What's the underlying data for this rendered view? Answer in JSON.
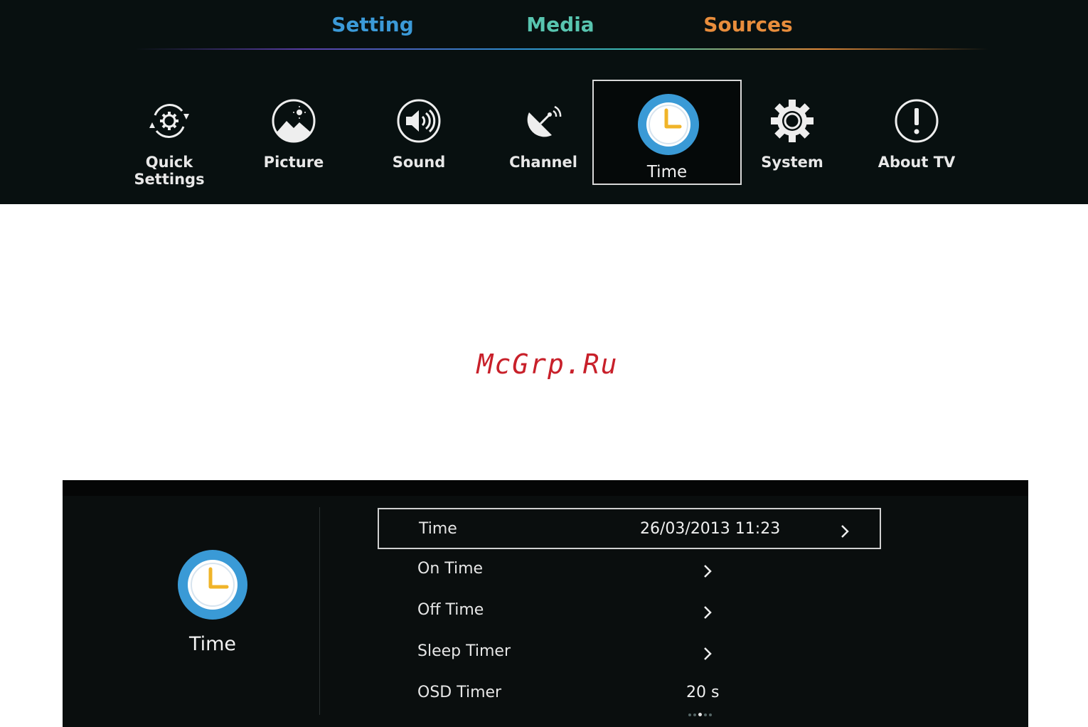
{
  "top_menu": {
    "tabs": [
      "Setting",
      "Media",
      "Sources"
    ],
    "items": [
      {
        "label": "Quick Settings",
        "icon": "quick-settings-icon"
      },
      {
        "label": "Picture",
        "icon": "picture-icon"
      },
      {
        "label": "Sound",
        "icon": "sound-icon"
      },
      {
        "label": "Channel",
        "icon": "satellite-dish-icon"
      },
      {
        "label": "Time",
        "icon": "clock-icon",
        "selected": true
      },
      {
        "label": "System",
        "icon": "gear-icon"
      },
      {
        "label": "About TV",
        "icon": "info-exclamation-icon"
      }
    ]
  },
  "watermark": "McGrp.Ru",
  "time_panel": {
    "title": "Time",
    "rows": [
      {
        "label": "Time",
        "value": "26/03/2013 11:23",
        "selected": true
      },
      {
        "label": "On Time",
        "value": ""
      },
      {
        "label": "Off Time",
        "value": ""
      },
      {
        "label": "Sleep Timer",
        "value": ""
      },
      {
        "label": "OSD Timer",
        "value": "20 s"
      }
    ]
  },
  "colors": {
    "setting_tab": "#3b9ad8",
    "media_tab": "#58c5b0",
    "sources_tab": "#e88d3c",
    "clock_blue": "#3a9ad6",
    "clock_hands": "#f0b429",
    "watermark": "#c8202a"
  }
}
